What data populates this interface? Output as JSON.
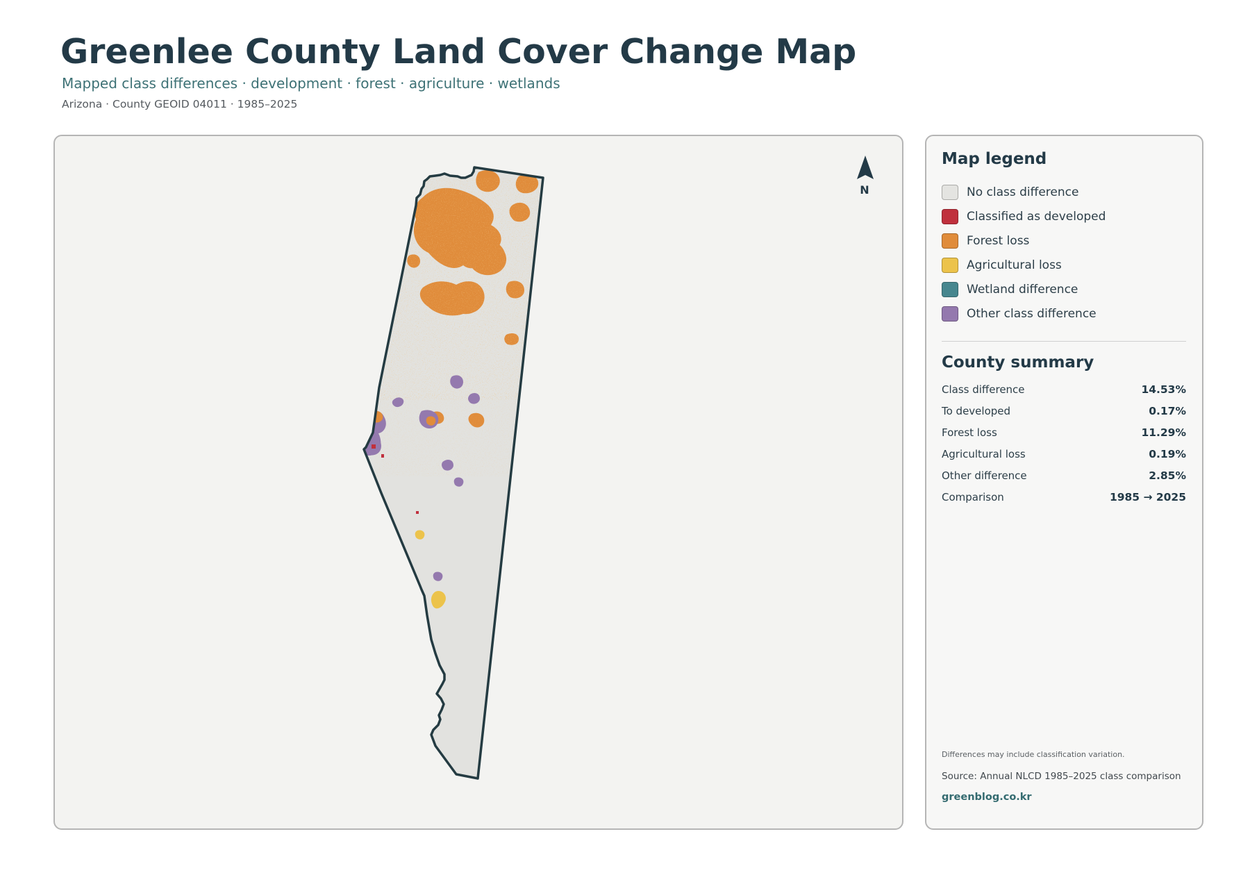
{
  "header": {
    "title": "Greenlee County Land Cover Change Map",
    "subtitle": "Mapped class differences · development · forest · agriculture · wetlands",
    "meta": "Arizona · County GEOID 04011 · 1985–2025"
  },
  "map": {
    "north_label": "N",
    "icons": [
      "north-arrow-icon"
    ],
    "colors": {
      "no_change": "#e2e2df",
      "developed": "#c0303d",
      "forest_loss": "#e08c3b",
      "agricultural_loss": "#ecc34b",
      "wetland": "#47878f",
      "other": "#9479ae",
      "outline": "#243b42"
    }
  },
  "legend": {
    "title": "Map legend",
    "items": [
      {
        "label": "No class difference",
        "color": "#e4e4e1"
      },
      {
        "label": "Classified as developed",
        "color": "#c0303d"
      },
      {
        "label": "Forest loss",
        "color": "#e08c3b"
      },
      {
        "label": "Agricultural loss",
        "color": "#ecc34b"
      },
      {
        "label": "Wetland difference",
        "color": "#47878f"
      },
      {
        "label": "Other class difference",
        "color": "#9479ae"
      }
    ]
  },
  "summary": {
    "title": "County summary",
    "rows": [
      {
        "label": "Class difference",
        "value": "14.53%"
      },
      {
        "label": "To developed",
        "value": "0.17%"
      },
      {
        "label": "Forest loss",
        "value": "11.29%"
      },
      {
        "label": "Agricultural loss",
        "value": "0.19%"
      },
      {
        "label": "Other difference",
        "value": "2.85%"
      },
      {
        "label": "Comparison",
        "value": "1985 → 2025"
      }
    ]
  },
  "footer": {
    "note": "Differences may include classification variation.",
    "source": "Source: Annual NLCD 1985–2025 class comparison",
    "site": "greenblog.co.kr"
  }
}
